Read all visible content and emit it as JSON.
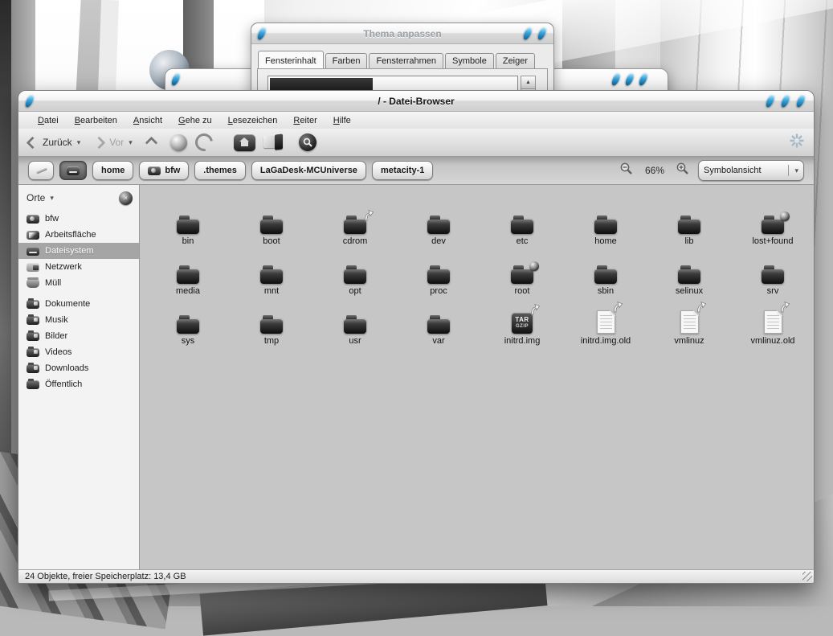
{
  "theme_window": {
    "title": "Thema anpassen",
    "tabs": [
      {
        "label": "Fensterinhalt",
        "active": true
      },
      {
        "label": "Farben"
      },
      {
        "label": "Fensterrahmen"
      },
      {
        "label": "Symbole"
      },
      {
        "label": "Zeiger"
      }
    ]
  },
  "file_browser": {
    "title": "/ - Datei-Browser",
    "menus": [
      "Datei",
      "Bearbeiten",
      "Ansicht",
      "Gehe zu",
      "Lesezeichen",
      "Reiter",
      "Hilfe"
    ],
    "toolbar": {
      "back_label": "Zurück",
      "forward_label": "Vor"
    },
    "pathbar": {
      "buttons": [
        {
          "label": "home"
        },
        {
          "label": "bfw",
          "icon": "camera"
        },
        {
          "label": ".themes"
        },
        {
          "label": "LaGaDesk-MCUniverse"
        },
        {
          "label": "metacity-1"
        }
      ],
      "zoom_level": "66%",
      "view_mode": "Symbolansicht"
    },
    "sidebar": {
      "header": "Orte",
      "items": [
        {
          "label": "bfw",
          "icon": "camera"
        },
        {
          "label": "Arbeitsfläche",
          "icon": "desktop"
        },
        {
          "label": "Dateisystem",
          "icon": "drive",
          "selected": true
        },
        {
          "label": "Netzwerk",
          "icon": "network"
        },
        {
          "label": "Müll",
          "icon": "trash",
          "gap_after": true
        },
        {
          "label": "Dokumente",
          "icon": "folder-doc"
        },
        {
          "label": "Musik",
          "icon": "folder-music"
        },
        {
          "label": "Bilder",
          "icon": "folder-pic"
        },
        {
          "label": "Videos",
          "icon": "folder-video"
        },
        {
          "label": "Downloads",
          "icon": "folder-down"
        },
        {
          "label": "Öffentlich",
          "icon": "folder"
        }
      ]
    },
    "files": [
      {
        "name": "bin",
        "icon": "folder"
      },
      {
        "name": "boot",
        "icon": "folder"
      },
      {
        "name": "cdrom",
        "icon": "folder",
        "emblem": "symlink"
      },
      {
        "name": "dev",
        "icon": "folder"
      },
      {
        "name": "etc",
        "icon": "folder"
      },
      {
        "name": "home",
        "icon": "folder"
      },
      {
        "name": "lib",
        "icon": "folder"
      },
      {
        "name": "lost+found",
        "icon": "folder",
        "emblem": "no-access"
      },
      {
        "name": "media",
        "icon": "folder"
      },
      {
        "name": "mnt",
        "icon": "folder"
      },
      {
        "name": "opt",
        "icon": "folder"
      },
      {
        "name": "proc",
        "icon": "folder"
      },
      {
        "name": "root",
        "icon": "folder",
        "emblem": "no-access"
      },
      {
        "name": "sbin",
        "icon": "folder"
      },
      {
        "name": "selinux",
        "icon": "folder"
      },
      {
        "name": "srv",
        "icon": "folder"
      },
      {
        "name": "sys",
        "icon": "folder"
      },
      {
        "name": "tmp",
        "icon": "folder"
      },
      {
        "name": "usr",
        "icon": "folder"
      },
      {
        "name": "var",
        "icon": "folder"
      },
      {
        "name": "initrd.img",
        "icon": "targz",
        "emblem": "symlink"
      },
      {
        "name": "initrd.img.old",
        "icon": "doc",
        "emblem": "symlink"
      },
      {
        "name": "vmlinuz",
        "icon": "doc",
        "emblem": "symlink"
      },
      {
        "name": "vmlinuz.old",
        "icon": "doc",
        "emblem": "symlink"
      }
    ],
    "icon_text": {
      "targz_top": "TAR",
      "targz_bottom": "GZIP"
    },
    "statusbar": "24 Objekte, freier Speicherplatz: 13,4 GB"
  },
  "colors": {
    "accent_blue": "#2e9fd6",
    "selection_gray": "#a5a5a5",
    "content_bg": "#c6c6c6"
  }
}
